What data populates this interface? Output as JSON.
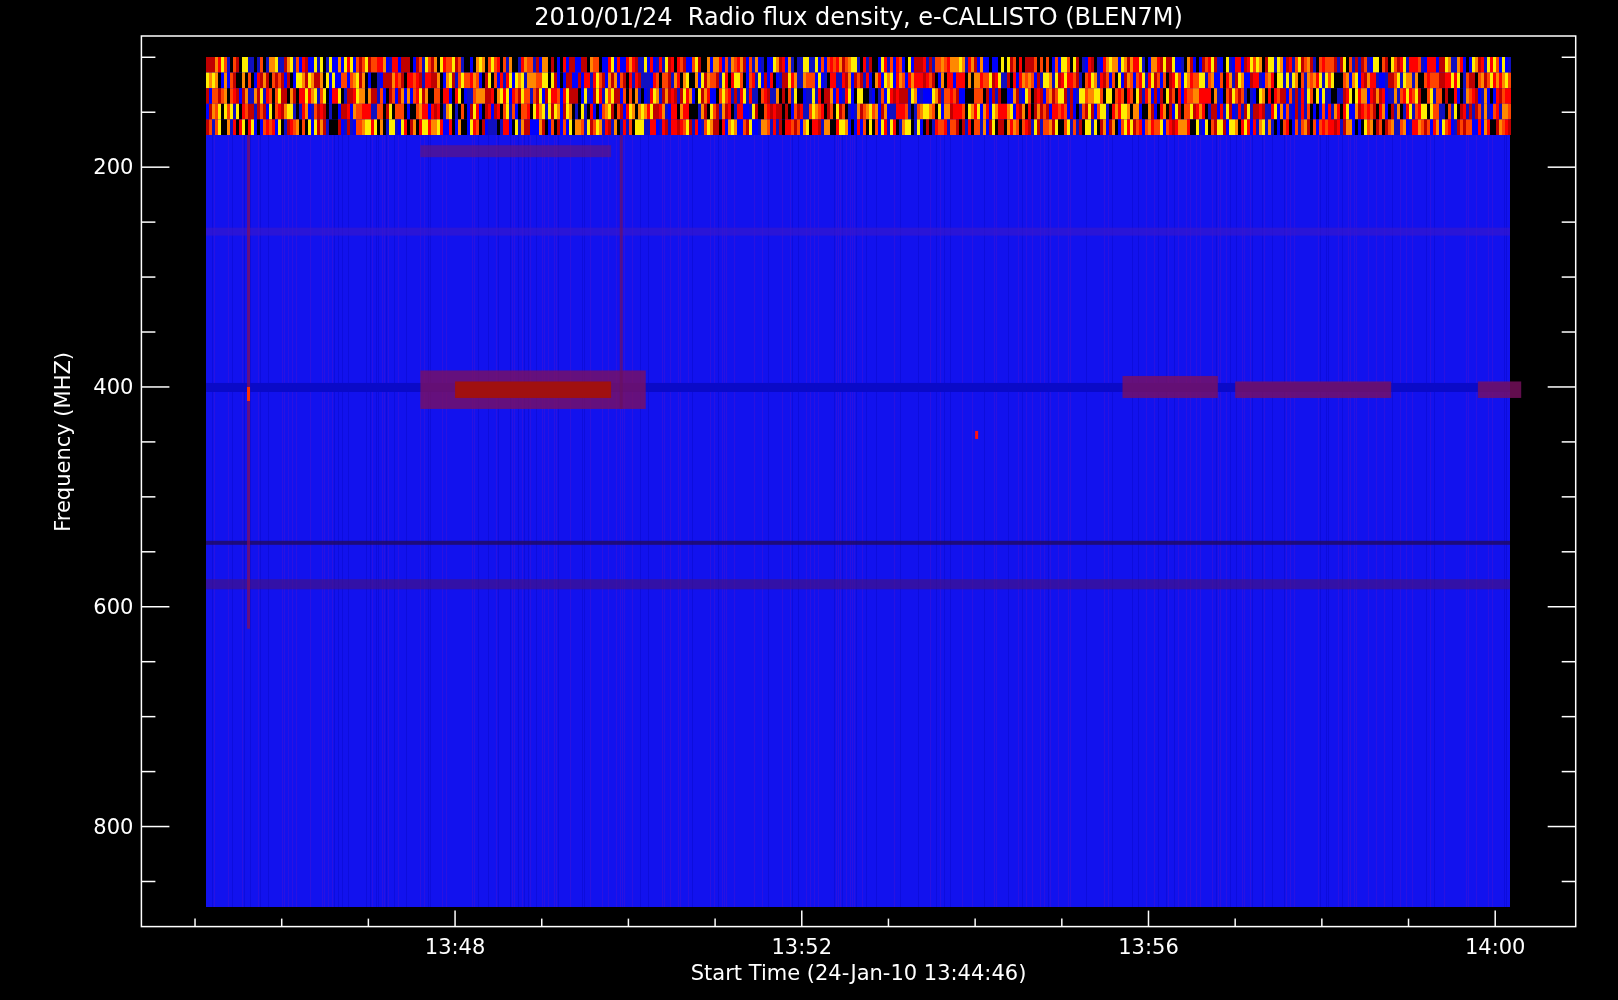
{
  "title": "2010/01/24  Radio flux density, e-CALLISTO (BLEN7M)",
  "ylabel": "Frequency (MHZ)",
  "xlabel": "Start Time (24-Jan-10 13:44:46)",
  "yticks": [
    "200",
    "400",
    "600",
    "800"
  ],
  "xticks": [
    "13:48",
    "13:52",
    "13:56",
    "14:00"
  ]
}
